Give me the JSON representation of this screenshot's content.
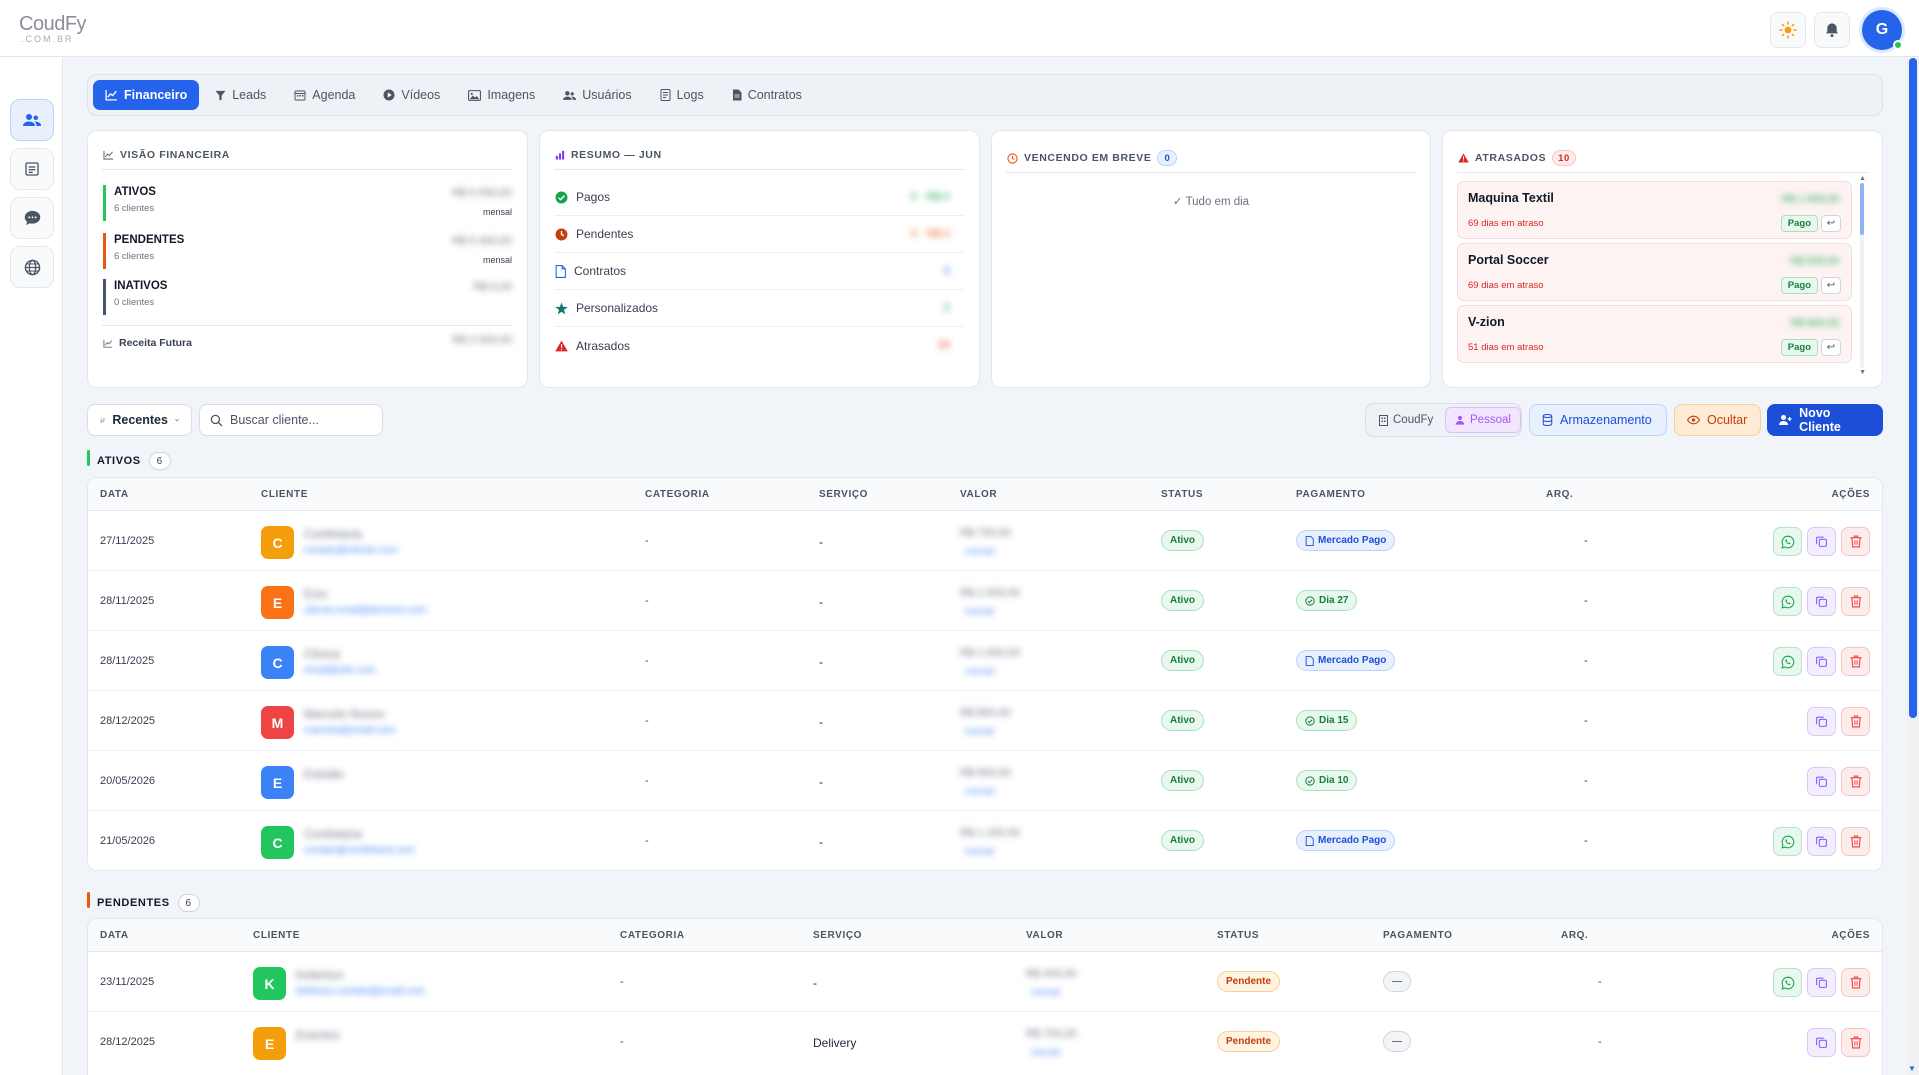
{
  "app": {
    "logo_main": "CoudFy",
    "logo_sub": ".COM.BR",
    "avatar_initial": "G"
  },
  "tabs": [
    {
      "label": "Financeiro",
      "icon": "chart-line-icon",
      "active": true
    },
    {
      "label": "Leads",
      "icon": "filter-icon"
    },
    {
      "label": "Agenda",
      "icon": "calendar-icon"
    },
    {
      "label": "Vídeos",
      "icon": "play-circle-icon"
    },
    {
      "label": "Imagens",
      "icon": "image-icon"
    },
    {
      "label": "Usuários",
      "icon": "users-icon"
    },
    {
      "label": "Logs",
      "icon": "log-icon"
    },
    {
      "label": "Contratos",
      "icon": "file-icon"
    }
  ],
  "visao": {
    "title": "VISÃO FINANCEIRA",
    "rows": [
      {
        "name": "ATIVOS",
        "sub": "6 clientes",
        "value": "R$ 5.550,00",
        "period": "mensal",
        "color": "#22c55e"
      },
      {
        "name": "PENDENTES",
        "sub": "6 clientes",
        "value": "R$ 5.400,00",
        "period": "mensal",
        "color": "#ea580c"
      },
      {
        "name": "INATIVOS",
        "sub": "0 clientes",
        "value": "R$ 0,00",
        "period": "",
        "color": "#475569"
      }
    ],
    "receita_label": "Receita Futura",
    "receita_value": "R$ 2.000,00"
  },
  "resumo": {
    "title": "RESUMO — JUN",
    "rows": [
      {
        "label": "Pagos",
        "icon": "check-circle-icon",
        "icon_color": "#16a34a",
        "value": "0 · R$ 0"
      },
      {
        "label": "Pendentes",
        "icon": "clock-icon",
        "icon_color": "#c2410c",
        "value": "0 · R$ 0"
      },
      {
        "label": "Contratos",
        "icon": "document-icon",
        "icon_color": "#2563eb",
        "value": "0"
      },
      {
        "label": "Personalizados",
        "icon": "star-icon",
        "icon_color": "#0f766e",
        "value": "0"
      },
      {
        "label": "Atrasados",
        "icon": "warning-icon",
        "icon_color": "#dc2626",
        "value": "10"
      }
    ]
  },
  "vencendo": {
    "title": "VENCENDO EM BREVE",
    "count": "0",
    "empty": "Tudo em dia"
  },
  "atrasados": {
    "title": "ATRASADOS",
    "count": "10",
    "items": [
      {
        "name": "Maquina Textil",
        "days": "69 dias em atraso",
        "value": "R$ 1.000,00",
        "status": "Pago",
        "undo": "↩"
      },
      {
        "name": "Portal Soccer",
        "days": "69 dias em atraso",
        "value": "R$ 500,00",
        "status": "Pago",
        "undo": "↩"
      },
      {
        "name": "V-zion",
        "days": "51 dias em atraso",
        "value": "R$ 800,00",
        "status": "Pago",
        "undo": "↩"
      }
    ]
  },
  "toolbar": {
    "sort_label": "Recentes",
    "search_placeholder": "Buscar cliente...",
    "seg_coudfy": "CoudFy",
    "seg_pessoal": "Pessoal",
    "armazenamento": "Armazenamento",
    "ocultar": "Ocultar",
    "novo_cliente": "Novo Cliente"
  },
  "columns": {
    "data": "DATA",
    "cliente": "CLIENTE",
    "categoria": "CATEGORIA",
    "servico": "SERVIÇO",
    "valor": "VALOR",
    "status": "STATUS",
    "pagamento": "PAGAMENTO",
    "arq": "ARQ.",
    "acoes": "AÇÕES"
  },
  "ativos": {
    "title": "ATIVOS",
    "count": "6",
    "rows": [
      {
        "date": "27/11/2025",
        "initial": "C",
        "color": "#f59e0b",
        "name": "Confeitaria",
        "email": "contato@cliente.com",
        "categoria": "-",
        "servico": "-",
        "valor": "R$ 700,00",
        "valor_sub": "mensal",
        "status": "Ativo",
        "pagamento": "Mercado Pago",
        "pay_type": "mp",
        "arq": "-",
        "wa": true
      },
      {
        "date": "28/11/2025",
        "initial": "E",
        "color": "#f97316",
        "name": "Ezio",
        "email": "cliente.email@dominio.com",
        "categoria": "-",
        "servico": "-",
        "valor": "R$ 1.000,00",
        "valor_sub": "mensal",
        "status": "Ativo",
        "pagamento": "Dia 27",
        "pay_type": "dia",
        "arq": "-",
        "wa": true
      },
      {
        "date": "28/11/2025",
        "initial": "C",
        "color": "#3b82f6",
        "name": "Clinica",
        "email": "email@site.com",
        "categoria": "-",
        "servico": "-",
        "valor": "R$ 1.000,00",
        "valor_sub": "mensal",
        "status": "Ativo",
        "pagamento": "Mercado Pago",
        "pay_type": "mp",
        "arq": "-",
        "wa": true
      },
      {
        "date": "28/12/2025",
        "initial": "M",
        "color": "#ef4444",
        "name": "Marcelo Nunes",
        "email": "marcelo@email.com",
        "categoria": "-",
        "servico": "-",
        "valor": "R$ 800,00",
        "valor_sub": "mensal",
        "status": "Ativo",
        "pagamento": "Dia 15",
        "pay_type": "dia",
        "arq": "-",
        "wa": false
      },
      {
        "date": "20/05/2026",
        "initial": "E",
        "color": "#3b82f6",
        "name": "Estúdio",
        "email": "",
        "categoria": "-",
        "servico": "-",
        "valor": "R$ 900,00",
        "valor_sub": "mensal",
        "status": "Ativo",
        "pagamento": "Dia 10",
        "pay_type": "dia",
        "arq": "-",
        "wa": false
      },
      {
        "date": "21/05/2026",
        "initial": "C",
        "color": "#22c55e",
        "name": "Confeitaria",
        "email": "contato@confeitaria.com",
        "categoria": "-",
        "servico": "-",
        "valor": "R$ 1.150,00",
        "valor_sub": "mensal",
        "status": "Ativo",
        "pagamento": "Mercado Pago",
        "pay_type": "mp",
        "arq": "-",
        "wa": true
      }
    ]
  },
  "pendentes": {
    "title": "PENDENTES",
    "count": "6",
    "rows": [
      {
        "date": "23/11/2025",
        "initial": "K",
        "color": "#22c55e",
        "name": "Kellerton",
        "email": "kellerton.contato@email.com",
        "categoria": "-",
        "servico": "-",
        "valor": "R$ 400,00",
        "valor_sub": "mensal",
        "status": "Pendente",
        "pagamento": "—",
        "arq": "-",
        "wa": true
      },
      {
        "date": "28/12/2025",
        "initial": "E",
        "color": "#f59e0b",
        "name": "Eventos",
        "email": "",
        "categoria": "-",
        "servico": "Delivery",
        "valor": "R$ 700,00",
        "valor_sub": "mensal",
        "status": "Pendente",
        "pagamento": "—",
        "arq": "-",
        "wa": false
      }
    ]
  }
}
